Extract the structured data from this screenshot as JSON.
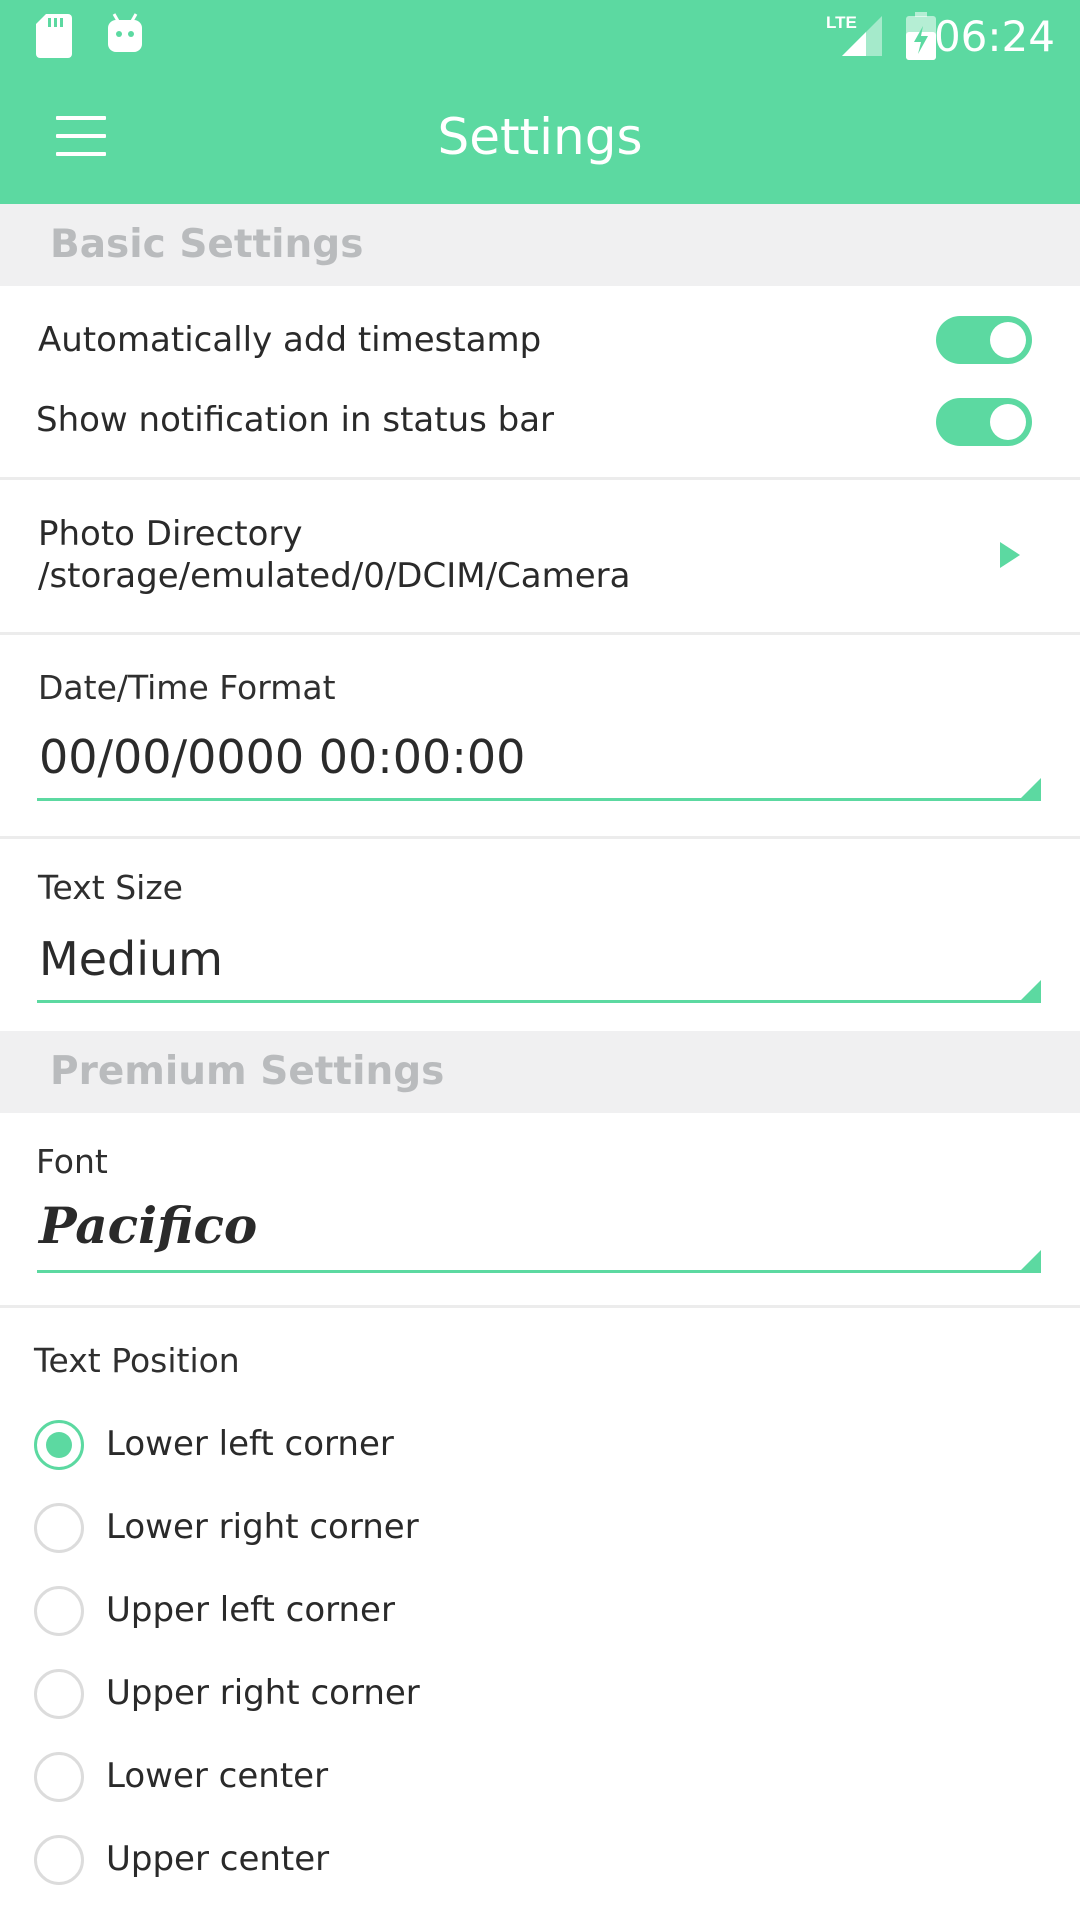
{
  "status_bar": {
    "time": "06:24",
    "network": "LTE",
    "icons": [
      "sd-card-icon",
      "android-icon",
      "lte-signal-icon",
      "battery-charging-icon"
    ]
  },
  "toolbar": {
    "title": "Settings",
    "menu_icon": "hamburger-menu-icon"
  },
  "basic_settings": {
    "header": "Basic Settings",
    "timestamp_toggle": {
      "label": "Automatically add timestamp",
      "on": true
    },
    "notification_toggle": {
      "label": "Show notification in status bar",
      "on": true
    },
    "photo_directory": {
      "label": "Photo Directory",
      "value": "/storage/emulated/0/DCIM/Camera"
    },
    "datetime_format": {
      "label": "Date/Time Format",
      "value": "00/00/0000 00:00:00"
    },
    "text_size": {
      "label": "Text Size",
      "value": "Medium"
    }
  },
  "premium_settings": {
    "header": "Premium Settings",
    "font": {
      "label": "Font",
      "value": "Pacifico"
    },
    "text_position": {
      "label": "Text Position",
      "selected": "Lower left corner",
      "options": [
        "Lower left corner",
        "Lower right corner",
        "Upper left corner",
        "Upper right corner",
        "Lower center",
        "Upper center"
      ]
    }
  },
  "colors": {
    "accent": "#5cd9a1",
    "section_bg": "#f0f0f1",
    "section_text": "#b9bbbd"
  }
}
